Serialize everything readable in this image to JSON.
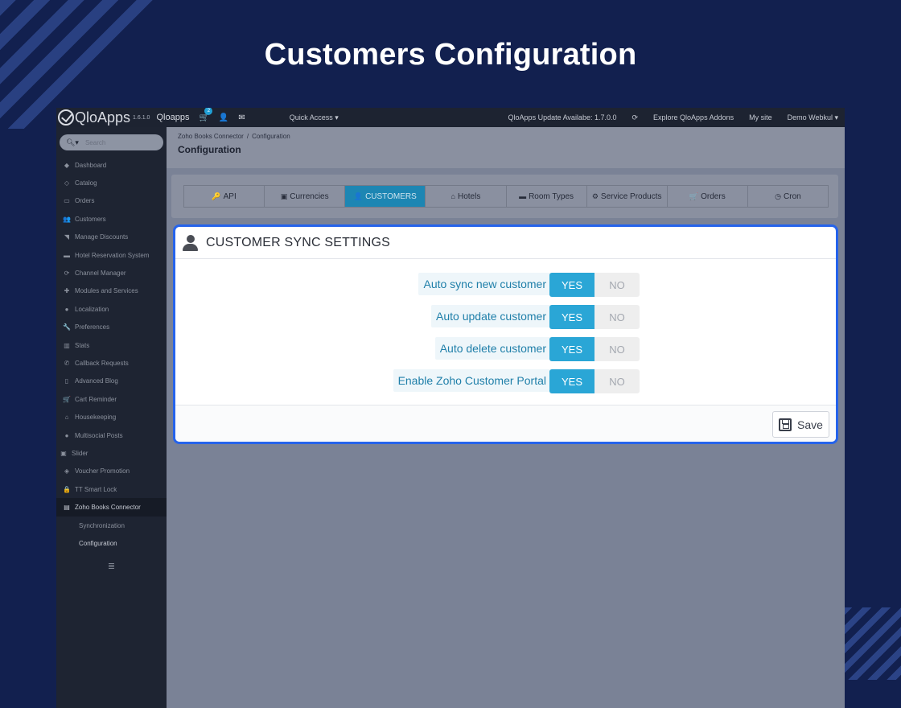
{
  "hero": {
    "title": "Customers Configuration"
  },
  "topbar": {
    "logo": "QloApps",
    "version": "1.6.1.0",
    "shop": "Qloapps",
    "cart_count": "2",
    "quick_access": "Quick Access ▾",
    "update": "QloApps Update Availabe: 1.7.0.0",
    "explore": "Explore QloApps Addons",
    "my_site": "My site",
    "user": "Demo Webkul ▾"
  },
  "sidebar": {
    "search_placeholder": "Search",
    "items": [
      {
        "label": "Dashboard",
        "icon": "dashboard-icon"
      },
      {
        "label": "Catalog",
        "icon": "catalog-icon"
      },
      {
        "label": "Orders",
        "icon": "orders-icon"
      },
      {
        "label": "Customers",
        "icon": "users-icon"
      },
      {
        "label": "Manage Discounts",
        "icon": "tag-icon"
      },
      {
        "label": "Hotel Reservation System",
        "icon": "bed-icon"
      },
      {
        "label": "Channel Manager",
        "icon": "refresh-icon"
      },
      {
        "label": "Modules and Services",
        "icon": "puzzle-icon"
      },
      {
        "label": "Localization",
        "icon": "globe-icon"
      },
      {
        "label": "Preferences",
        "icon": "wrench-icon"
      },
      {
        "label": "Stats",
        "icon": "bar-chart-icon"
      },
      {
        "label": "Callback Requests",
        "icon": "phone-icon"
      },
      {
        "label": "Advanced Blog",
        "icon": "bookmark-icon"
      },
      {
        "label": "Cart Reminder",
        "icon": "cart-icon"
      },
      {
        "label": "Housekeeping",
        "icon": "home-icon"
      },
      {
        "label": "Multisocial Posts",
        "icon": "globe-icon"
      },
      {
        "label": "Slider",
        "icon": "slider-icon"
      },
      {
        "label": "Voucher Promotion",
        "icon": "ticket-icon"
      },
      {
        "label": "TT Smart Lock",
        "icon": "lock-icon"
      },
      {
        "label": "Zoho Books Connector",
        "icon": "book-icon"
      }
    ],
    "subitems": [
      "Synchronization",
      "Configuration"
    ]
  },
  "page_head": {
    "breadcrumb_parent": "Zoho Books Connector",
    "breadcrumb_sep": "/",
    "breadcrumb_current": "Configuration",
    "title": "Configuration"
  },
  "tabs": [
    {
      "label": "API",
      "icon": "🔑"
    },
    {
      "label": "Currencies",
      "icon": "▣"
    },
    {
      "label": "CUSTOMERS",
      "icon": "👤"
    },
    {
      "label": "Hotels",
      "icon": "⌂"
    },
    {
      "label": "Room Types",
      "icon": "▬"
    },
    {
      "label": "Service Products",
      "icon": "⚙"
    },
    {
      "label": "Orders",
      "icon": "🛒"
    },
    {
      "label": "Cron",
      "icon": "◷"
    }
  ],
  "sync": {
    "title": "CUSTOMER SYNC SETTINGS",
    "rows": [
      {
        "label": "Auto sync new customer",
        "yes": "YES",
        "no": "NO"
      },
      {
        "label": "Auto update customer",
        "yes": "YES",
        "no": "NO"
      },
      {
        "label": "Auto delete customer",
        "yes": "YES",
        "no": "NO"
      },
      {
        "label": "Enable Zoho Customer Portal",
        "yes": "YES",
        "no": "NO"
      }
    ],
    "save_label": "Save"
  },
  "colors": {
    "accent": "#2aa6d6",
    "highlight_border": "#2563eb",
    "background": "#12204f"
  }
}
